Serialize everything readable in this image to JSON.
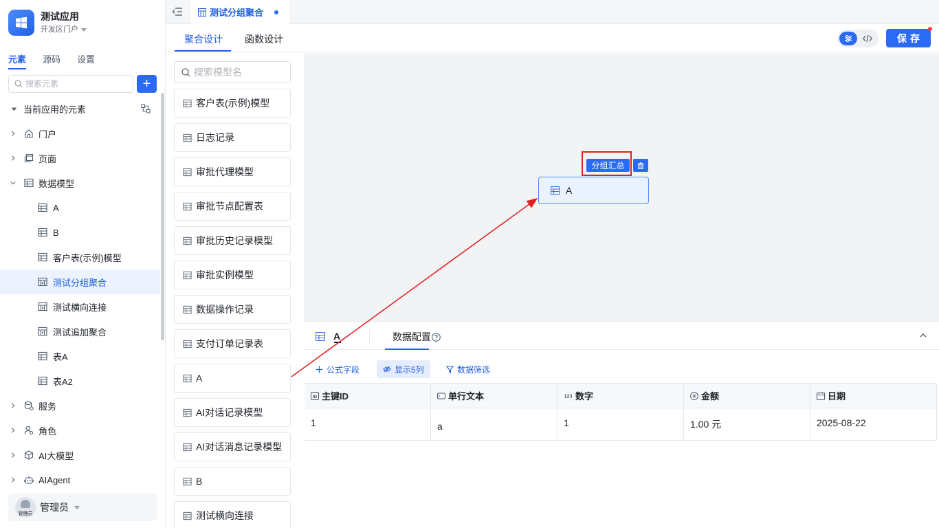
{
  "app": {
    "name": "测试应用",
    "portal": "开发区门户"
  },
  "sidebar": {
    "tabs": [
      {
        "label": "元素",
        "active": true
      },
      {
        "label": "源码",
        "active": false
      },
      {
        "label": "设置",
        "active": false
      }
    ],
    "search_placeholder": "搜索元素",
    "add_label": "+",
    "tree": [
      {
        "label": "当前应用的元素",
        "level": 0,
        "expanded": true,
        "icon": "none"
      },
      {
        "label": "门户",
        "level": 1,
        "expanded": false,
        "icon": "home-icon"
      },
      {
        "label": "页面",
        "level": 1,
        "expanded": false,
        "icon": "page-icon"
      },
      {
        "label": "数据模型",
        "level": 1,
        "expanded": true,
        "icon": "table-icon"
      },
      {
        "label": "A",
        "level": 2,
        "icon": "table-icon"
      },
      {
        "label": "B",
        "level": 2,
        "icon": "table-icon"
      },
      {
        "label": "客户表(示例)模型",
        "level": 2,
        "icon": "table-icon"
      },
      {
        "label": "测试分组聚合",
        "level": 2,
        "icon": "aggregate-icon",
        "selected": true
      },
      {
        "label": "测试横向连接",
        "level": 2,
        "icon": "aggregate-icon"
      },
      {
        "label": "测试追加聚合",
        "level": 2,
        "icon": "aggregate-icon"
      },
      {
        "label": "表A",
        "level": 2,
        "icon": "table-icon"
      },
      {
        "label": "表A2",
        "level": 2,
        "icon": "table-icon"
      },
      {
        "label": "服务",
        "level": 1,
        "expanded": false,
        "icon": "service-icon"
      },
      {
        "label": "角色",
        "level": 1,
        "expanded": false,
        "icon": "role-icon"
      },
      {
        "label": "AI大模型",
        "level": 1,
        "expanded": false,
        "icon": "ai-model-icon"
      },
      {
        "label": "AIAgent",
        "level": 1,
        "expanded": false,
        "icon": "robot-icon"
      }
    ],
    "user": {
      "name": "管理员",
      "avatar_text": "管理员"
    }
  },
  "topbar": {
    "file_tab": "测试分组聚合"
  },
  "subbar": {
    "tabs": [
      {
        "label": "聚合设计",
        "active": true
      },
      {
        "label": "函数设计",
        "active": false
      }
    ],
    "save_label": "保存"
  },
  "models": {
    "search_placeholder": "搜索模型名",
    "items": [
      "客户表(示例)模型",
      "日志记录",
      "审批代理模型",
      "审批节点配置表",
      "审批历史记录模型",
      "审批实例模型",
      "数据操作记录",
      "支付订单记录表",
      "A",
      "AI对话记录模型",
      "AI对话消息记录模型",
      "B",
      "测试横向连接"
    ]
  },
  "canvas": {
    "group_tag": "分组汇总",
    "node_label": "A"
  },
  "bottom": {
    "model_tab": "A",
    "config_tab": "数据配置",
    "actions": [
      {
        "label": "公式字段",
        "icon": "plus-icon"
      },
      {
        "label": "显示5列",
        "icon": "eye-icon"
      },
      {
        "label": "数据筛选",
        "icon": "filter-icon"
      }
    ],
    "columns": [
      {
        "label": "主键ID",
        "icon": "id-icon"
      },
      {
        "label": "单行文本",
        "icon": "text-icon"
      },
      {
        "label": "数字",
        "icon": "number-icon"
      },
      {
        "label": "金额",
        "icon": "money-icon"
      },
      {
        "label": "日期",
        "icon": "date-icon"
      }
    ],
    "rows": [
      [
        "1",
        "a",
        "1",
        "1.00 元",
        "2025-08-22"
      ]
    ]
  },
  "colors": {
    "primary": "#2b6bf3",
    "annotation": "#e02020"
  }
}
